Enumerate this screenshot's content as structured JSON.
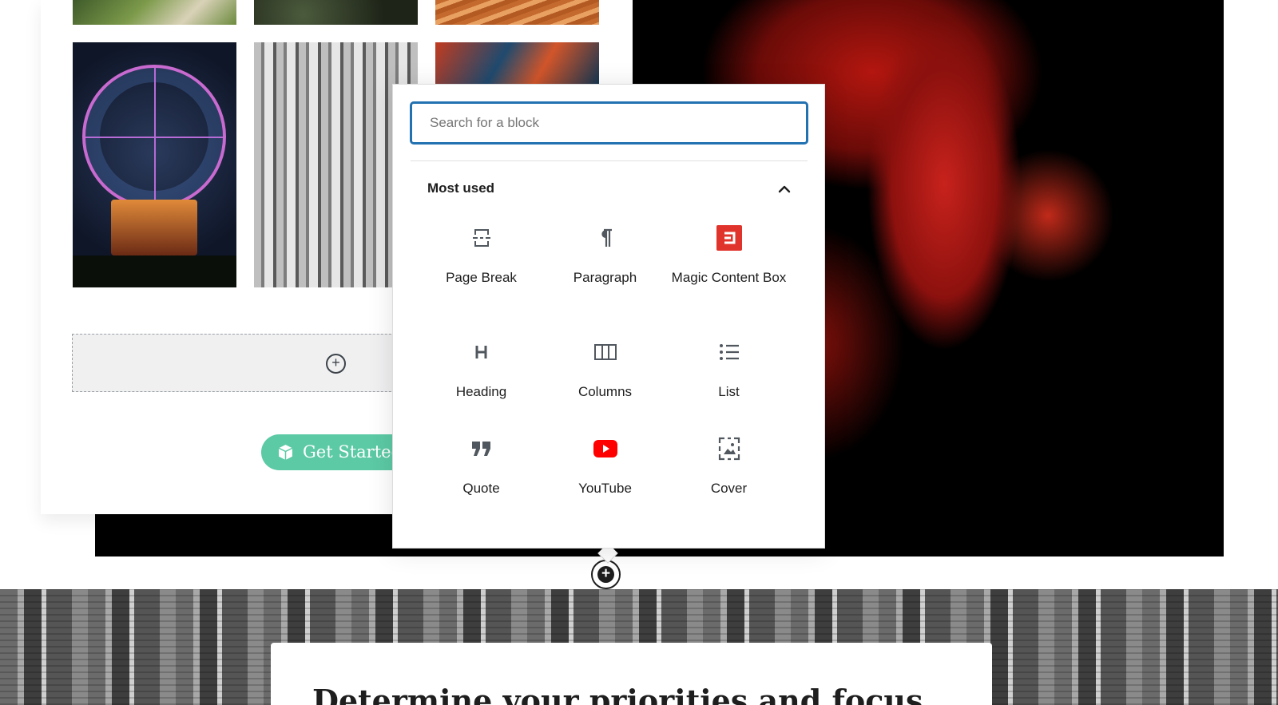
{
  "background_page": {
    "get_started_label": "Get Started",
    "section_heading": "Determine your priorities and focus"
  },
  "inserter": {
    "search_placeholder": "Search for a block",
    "panel_title": "Most used",
    "blocks": [
      {
        "label": "Page Break",
        "icon": "page-break-icon"
      },
      {
        "label": "Paragraph",
        "icon": "paragraph-icon"
      },
      {
        "label": "Magic Content Box",
        "icon": "magic-content-box-icon"
      },
      {
        "label": "Heading",
        "icon": "heading-icon"
      },
      {
        "label": "Columns",
        "icon": "columns-icon"
      },
      {
        "label": "List",
        "icon": "list-icon"
      },
      {
        "label": "Quote",
        "icon": "quote-icon"
      },
      {
        "label": "YouTube",
        "icon": "youtube-icon"
      },
      {
        "label": "Cover",
        "icon": "cover-icon"
      }
    ]
  },
  "colors": {
    "accent_blue": "#2271b1",
    "button_green": "#5ccaa5",
    "magic_box_red": "#e0332b",
    "youtube_red": "#ff0000"
  }
}
